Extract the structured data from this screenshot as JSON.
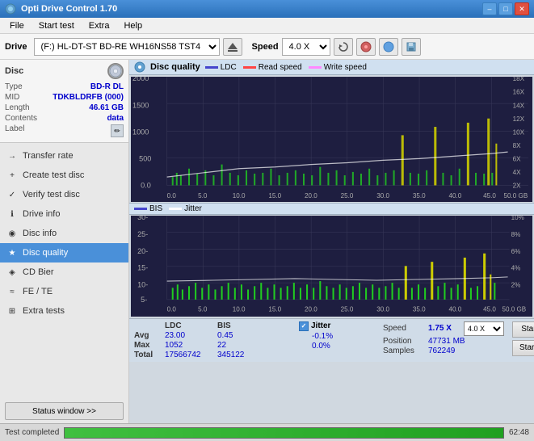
{
  "window": {
    "title": "Opti Drive Control 1.70",
    "minimize": "–",
    "maximize": "□",
    "close": "✕"
  },
  "menu": {
    "items": [
      "File",
      "Start test",
      "Extra",
      "Help"
    ]
  },
  "toolbar": {
    "drive_label": "Drive",
    "drive_value": "(F:)  HL-DT-ST BD-RE  WH16NS58 TST4",
    "speed_label": "Speed",
    "speed_value": "4.0 X"
  },
  "disc": {
    "title": "Disc",
    "type_label": "Type",
    "type_value": "BD-R DL",
    "mid_label": "MID",
    "mid_value": "TDKBLDRFB (000)",
    "length_label": "Length",
    "length_value": "46.61 GB",
    "contents_label": "Contents",
    "contents_value": "data",
    "label_label": "Label"
  },
  "nav": {
    "items": [
      {
        "id": "transfer-rate",
        "label": "Transfer rate",
        "icon": "→"
      },
      {
        "id": "create-test-disc",
        "label": "Create test disc",
        "icon": "+"
      },
      {
        "id": "verify-test-disc",
        "label": "Verify test disc",
        "icon": "✓"
      },
      {
        "id": "drive-info",
        "label": "Drive info",
        "icon": "ℹ"
      },
      {
        "id": "disc-info",
        "label": "Disc info",
        "icon": "💿"
      },
      {
        "id": "disc-quality",
        "label": "Disc quality",
        "icon": "★",
        "active": true
      },
      {
        "id": "cd-bier",
        "label": "CD Bier",
        "icon": "🍺"
      },
      {
        "id": "fe-te",
        "label": "FE / TE",
        "icon": "~"
      },
      {
        "id": "extra-tests",
        "label": "Extra tests",
        "icon": "⊞"
      }
    ]
  },
  "status_window_btn": "Status window >>",
  "chart": {
    "title": "Disc quality",
    "legend": {
      "ldc": "LDC",
      "read_speed": "Read speed",
      "write_speed": "Write speed"
    },
    "upper": {
      "y_max": 2000,
      "y_labels": [
        "2000",
        "1500",
        "1000",
        "500",
        "0.0"
      ],
      "right_labels": [
        "18X",
        "16X",
        "14X",
        "12X",
        "10X",
        "8X",
        "6X",
        "4X",
        "2X"
      ],
      "x_labels": [
        "0.0",
        "5.0",
        "10.0",
        "15.0",
        "20.0",
        "25.0",
        "30.0",
        "35.0",
        "40.0",
        "45.0",
        "50.0 GB"
      ]
    },
    "lower": {
      "title_legend": {
        "bis": "BIS",
        "jitter": "Jitter"
      },
      "y_labels": [
        "30-",
        "25-",
        "20-",
        "15-",
        "10-",
        "5-"
      ],
      "right_labels": [
        "10%",
        "8%",
        "6%",
        "4%",
        "2%"
      ],
      "x_labels": [
        "0.0",
        "5.0",
        "10.0",
        "15.0",
        "20.0",
        "25.0",
        "30.0",
        "35.0",
        "40.0",
        "45.0",
        "50.0 GB"
      ]
    }
  },
  "stats": {
    "headers": [
      "LDC",
      "BIS",
      "",
      "Jitter",
      "Speed"
    ],
    "rows": [
      {
        "label": "Avg",
        "ldc": "23.00",
        "bis": "0.45",
        "jitter": "-0.1%",
        "speed_label": "Speed",
        "speed_val": "1.75 X",
        "speed_val2": "4.0 X"
      },
      {
        "label": "Max",
        "ldc": "1052",
        "bis": "22",
        "jitter": "0.0%",
        "pos_label": "Position",
        "pos_val": "47731 MB"
      },
      {
        "label": "Total",
        "ldc": "17566742",
        "bis": "345122",
        "jitter": "",
        "samples_label": "Samples",
        "samples_val": "762249"
      }
    ],
    "jitter_label": "Jitter",
    "jitter_checked": true,
    "start_full": "Start full",
    "start_part": "Start part"
  },
  "progress": {
    "status": "Test completed",
    "percent": 100,
    "time": "62:48"
  }
}
